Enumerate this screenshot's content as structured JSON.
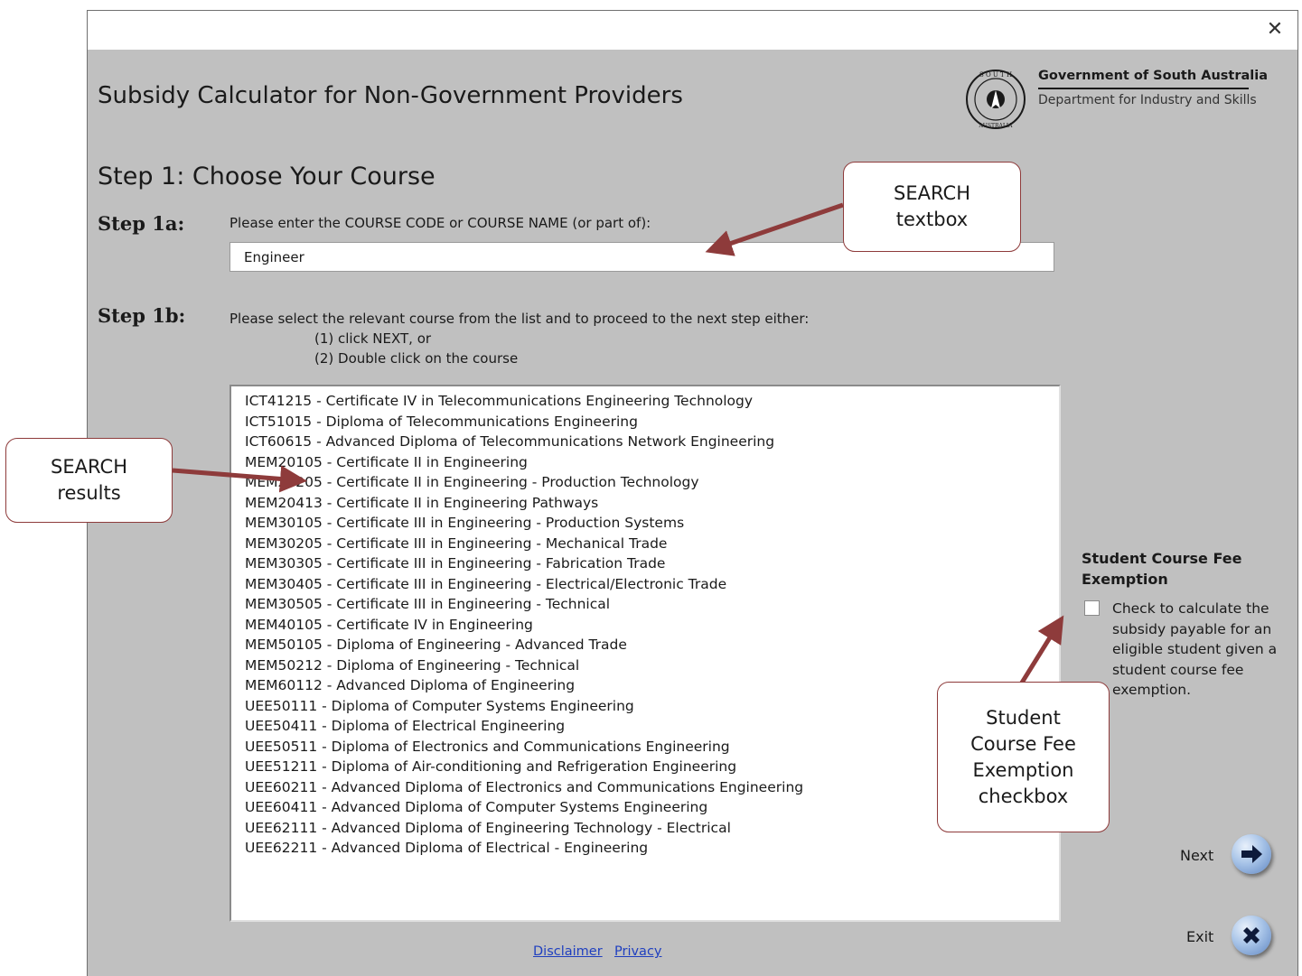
{
  "window": {
    "close_glyph": "✕"
  },
  "header": {
    "app_title": "Subsidy Calculator for Non-Government Providers",
    "gov_name": "Government of South Australia",
    "department": "Department for Industry and Skills",
    "seal_text_top": "SOUTH",
    "seal_text_bottom": "AUSTRALIA"
  },
  "step1": {
    "title": "Step 1: Choose Your Course",
    "a_label": "Step 1a:",
    "a_prompt": "Please enter the COURSE CODE or COURSE NAME (or part of):",
    "search_value": "Engineer",
    "b_label": "Step 1b:",
    "b_prompt": "Please select the relevant course from the list and to proceed to the next step either:",
    "b_option1": "(1) click NEXT, or",
    "b_option2": "(2) Double click on the course"
  },
  "results": [
    "ICT41215  -  Certificate IV in Telecommunications Engineering Technology",
    "ICT51015  -  Diploma of Telecommunications Engineering",
    "ICT60615  -  Advanced Diploma of Telecommunications Network Engineering",
    "MEM20105  -  Certificate II in Engineering",
    "MEM20205  -  Certificate II in Engineering - Production Technology",
    "MEM20413  -  Certificate II in Engineering Pathways",
    "MEM30105  -  Certificate III in Engineering - Production Systems",
    "MEM30205  -  Certificate III in Engineering - Mechanical Trade",
    "MEM30305  -  Certificate III in Engineering - Fabrication Trade",
    "MEM30405  -  Certificate III in Engineering - Electrical/Electronic Trade",
    "MEM30505  -  Certificate III in Engineering - Technical",
    "MEM40105  -  Certificate IV in Engineering",
    "MEM50105  -  Diploma of Engineering - Advanced Trade",
    "MEM50212  -  Diploma of Engineering - Technical",
    "MEM60112  -  Advanced Diploma of Engineering",
    "UEE50111  -  Diploma of Computer Systems Engineering",
    "UEE50411  -  Diploma of Electrical Engineering",
    "UEE50511  -  Diploma of Electronics and Communications Engineering",
    "UEE51211  -  Diploma of Air-conditioning and Refrigeration Engineering",
    "UEE60211  -  Advanced Diploma of Electronics and Communications Engineering",
    "UEE60411  -  Advanced Diploma of Computer Systems Engineering",
    "UEE62111  -  Advanced Diploma of Engineering Technology - Electrical",
    "UEE62211  -  Advanced Diploma of Electrical - Engineering"
  ],
  "exemption": {
    "title": "Student Course Fee Exemption",
    "description": "Check to calculate the subsidy payable for an eligible student given a student course fee exemption.",
    "checked": false
  },
  "nav": {
    "next_label": "Next",
    "exit_label": "Exit"
  },
  "footer": {
    "disclaimer": "Disclaimer",
    "privacy": "Privacy"
  },
  "callouts": {
    "search_textbox": "SEARCH textbox",
    "search_results": "SEARCH results",
    "exemption_checkbox": "Student Course Fee Exemption checkbox"
  },
  "colors": {
    "form_bg": "#c0c0c0",
    "callout_arrow": "#8e3b3b",
    "link": "#1f3fbf",
    "button_blue": "#5f86c2"
  }
}
